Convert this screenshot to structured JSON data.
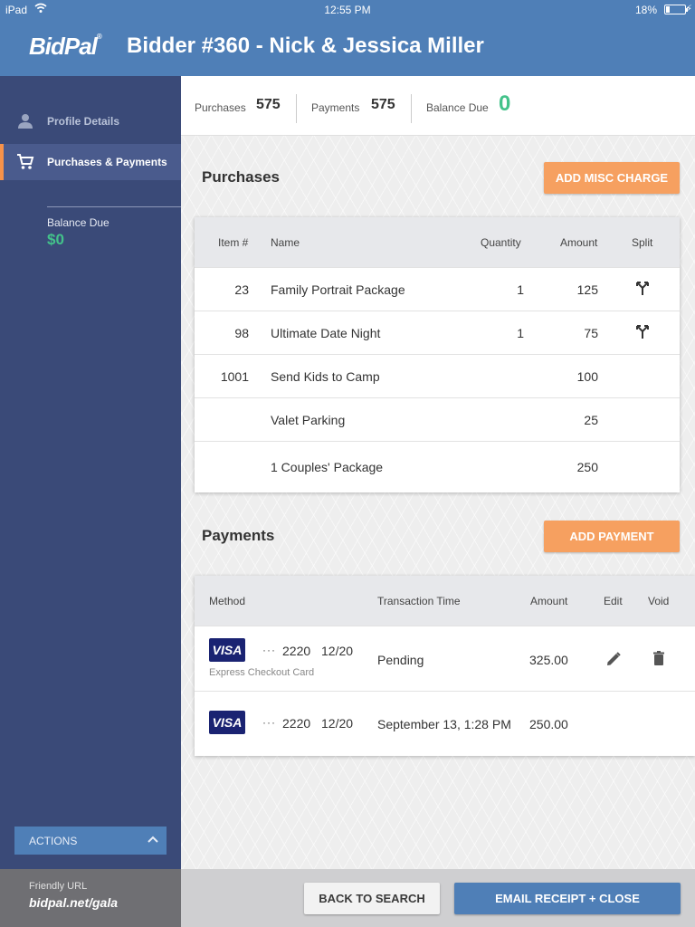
{
  "status_bar": {
    "device": "iPad",
    "time": "12:55 PM",
    "battery": "18%"
  },
  "header": {
    "logo": "BidPal",
    "title": "Bidder #360 - Nick & Jessica Miller"
  },
  "sidebar": {
    "items": [
      {
        "label": "Profile Details",
        "icon": "person-icon"
      },
      {
        "label": "Purchases & Payments",
        "icon": "cart-icon"
      }
    ],
    "balance_label": "Balance Due",
    "balance_value": "$0",
    "actions_label": "ACTIONS"
  },
  "summary": {
    "purchases_label": "Purchases",
    "purchases_value": "575",
    "payments_label": "Payments",
    "payments_value": "575",
    "balance_label": "Balance Due",
    "balance_value": "0"
  },
  "purchases": {
    "title": "Purchases",
    "add_button": "ADD MISC CHARGE",
    "columns": [
      "Item #",
      "Name",
      "Quantity",
      "Amount",
      "Split"
    ],
    "rows": [
      {
        "item": "23",
        "name": "Family Portrait Package",
        "qty": "1",
        "amount": "125",
        "split": true
      },
      {
        "item": "98",
        "name": "Ultimate Date Night",
        "qty": "1",
        "amount": "75",
        "split": true
      },
      {
        "item": "1001",
        "name": "Send Kids to Camp",
        "qty": "",
        "amount": "100",
        "split": false
      },
      {
        "item": "",
        "name": "Valet Parking",
        "qty": "",
        "amount": "25",
        "split": false
      },
      {
        "item": "",
        "name": "1 Couples' Package",
        "qty": "",
        "amount": "250",
        "split": false
      }
    ]
  },
  "payments": {
    "title": "Payments",
    "add_button": "ADD PAYMENT",
    "columns": [
      "Method",
      "Transaction Time",
      "Amount",
      "Edit",
      "Void"
    ],
    "rows": [
      {
        "card": "VISA",
        "dots": "···",
        "last4": "2220",
        "exp": "12/20",
        "sublabel": "Express Checkout Card",
        "time": "Pending",
        "amount": "325.00"
      },
      {
        "card": "VISA",
        "dots": "···",
        "last4": "2220",
        "exp": "12/20",
        "sublabel": "",
        "time": "September 13, 1:28 PM",
        "amount": "250.00"
      }
    ]
  },
  "footer": {
    "friendly_url_label": "Friendly URL",
    "friendly_url": "bidpal.net/gala",
    "back_button": "BACK TO SEARCH",
    "email_button": "EMAIL RECEIPT + CLOSE"
  },
  "colors": {
    "header": "#4f7fb7",
    "sidebar": "#3a4a78",
    "accent_orange": "#f6a060",
    "balance_green": "#43c28a",
    "visa_blue": "#1a2372"
  }
}
